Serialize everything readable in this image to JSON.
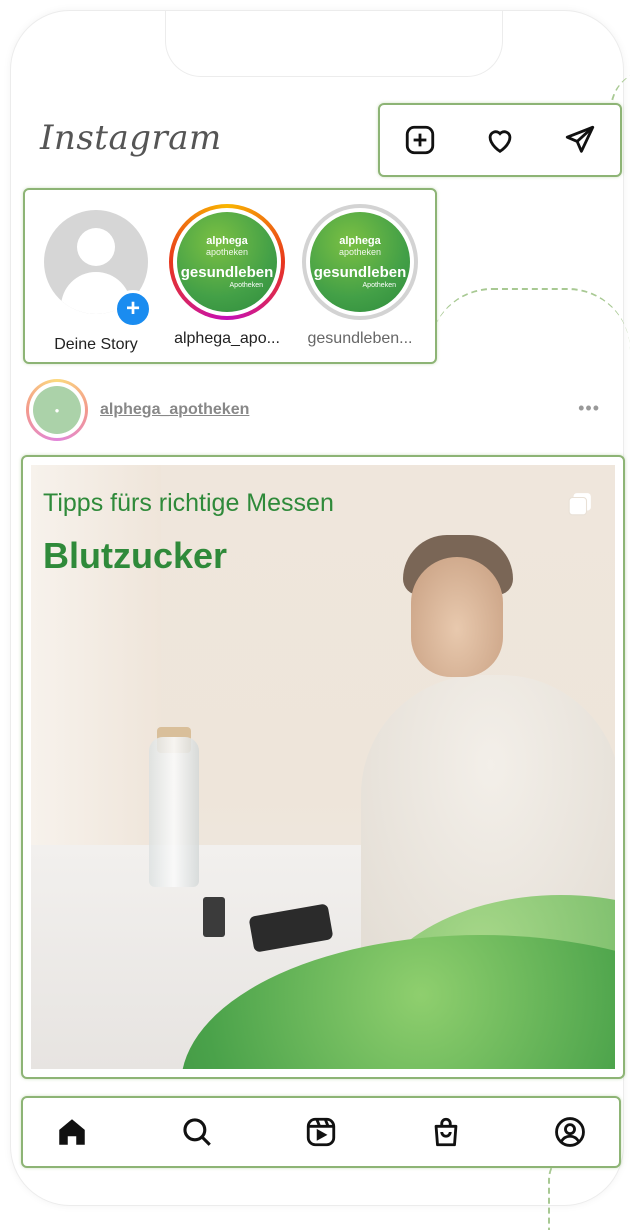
{
  "header": {
    "logo_text": "Instagram",
    "actions": [
      {
        "name": "new-post",
        "icon": "plus-square-icon"
      },
      {
        "name": "activity",
        "icon": "heart-icon"
      },
      {
        "name": "direct",
        "icon": "paper-plane-icon"
      }
    ]
  },
  "stories": {
    "items": [
      {
        "label": "Deine Story",
        "type": "own",
        "badge": "+"
      },
      {
        "label": "alphega_apo...",
        "type": "unseen",
        "brand_top": "alphega",
        "brand_sub": "apotheken",
        "brand_main": "gesundleben",
        "brand_foot": "Apotheken"
      },
      {
        "label": "gesundleben...",
        "type": "seen",
        "brand_top": "alphega",
        "brand_sub": "apotheken",
        "brand_main": "gesundleben",
        "brand_foot": "Apotheken"
      }
    ]
  },
  "post": {
    "username": "alphega_apotheken",
    "more": "•••",
    "image": {
      "title_line1": "Tipps fürs richtige Messen",
      "title_line2": "Blutzucker"
    }
  },
  "tabbar": {
    "items": [
      "home-icon",
      "search-icon",
      "reels-icon",
      "shop-icon",
      "profile-icon"
    ]
  },
  "colors": {
    "highlight_border": "#8db475",
    "brand_green": "#2f8a3a",
    "badge_blue": "#1a8cf0"
  }
}
